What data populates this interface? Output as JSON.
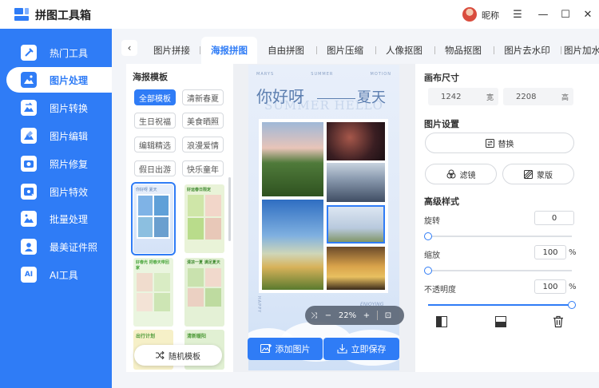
{
  "app": {
    "title": "拼图工具箱",
    "nickname": "昵称"
  },
  "window": {
    "menu_icon": "☰",
    "minimize_icon": "—",
    "maximize_icon": "☐",
    "close_icon": "✕"
  },
  "sidebar": {
    "items": [
      {
        "label": "热门工具",
        "icon": "tools-icon",
        "active": false
      },
      {
        "label": "图片处理",
        "icon": "image-process-icon",
        "active": true
      },
      {
        "label": "图片转换",
        "icon": "image-convert-icon",
        "active": false
      },
      {
        "label": "图片编辑",
        "icon": "image-edit-icon",
        "active": false
      },
      {
        "label": "照片修复",
        "icon": "photo-repair-icon",
        "active": false
      },
      {
        "label": "图片特效",
        "icon": "image-effect-icon",
        "active": false
      },
      {
        "label": "批量处理",
        "icon": "batch-icon",
        "active": false
      },
      {
        "label": "最美证件照",
        "icon": "id-photo-icon",
        "active": false
      },
      {
        "label": "AI工具",
        "icon": "ai-icon",
        "active": false
      }
    ]
  },
  "tabs": {
    "back_icon": "‹",
    "items": [
      {
        "label": "图片拼接",
        "active": false
      },
      {
        "label": "海报拼图",
        "active": true
      },
      {
        "label": "自由拼图",
        "active": false
      },
      {
        "label": "图片压缩",
        "active": false
      },
      {
        "label": "人像抠图",
        "active": false
      },
      {
        "label": "物品抠图",
        "active": false
      },
      {
        "label": "图片去水印",
        "active": false
      },
      {
        "label": "图片加水",
        "active": false
      }
    ]
  },
  "templates": {
    "title": "海报模板",
    "categories": [
      {
        "label": "全部模板",
        "active": true
      },
      {
        "label": "清新春夏",
        "active": false
      },
      {
        "label": "生日祝福",
        "active": false
      },
      {
        "label": "美食晒照",
        "active": false
      },
      {
        "label": "编辑精选",
        "active": false
      },
      {
        "label": "浪漫爱情",
        "active": false
      },
      {
        "label": "假日出游",
        "active": false
      },
      {
        "label": "快乐童年",
        "active": false
      }
    ],
    "thumbs": [
      {
        "caption": "你好呀 夏天",
        "selected": true
      },
      {
        "caption": "好运春日限定",
        "selected": false
      },
      {
        "caption": "好春光 把春天带回家",
        "selected": false
      },
      {
        "caption": "清凉一夏 满足夏天",
        "selected": false
      },
      {
        "caption": "出行计划",
        "selected": false
      },
      {
        "caption": "清新暖阳",
        "selected": false
      }
    ],
    "random_label": "随机模板"
  },
  "poster": {
    "top_left": "MARYS",
    "top_mid": "SUMMER",
    "top_right": "MOTION",
    "heading_left": "你好呀",
    "heading_right": "夏天",
    "bg_text": "SUMMER HELLO",
    "bottom_left": "HAPPY",
    "bottom_right": "ENJOYING"
  },
  "zoom": {
    "shuffle_icon": "⤨",
    "minus": "−",
    "value": "22%",
    "plus": "+",
    "fit_icon": "⊡"
  },
  "actions": {
    "add_image": "添加图片",
    "save_now": "立即保存"
  },
  "settings": {
    "canvas_size_title": "画布尺寸",
    "width": "1242",
    "width_unit": "宽",
    "height": "2208",
    "height_unit": "高",
    "image_settings_title": "图片设置",
    "replace_label": "替换",
    "filter_label": "滤镜",
    "mask_label": "蒙版",
    "advanced_title": "高级样式",
    "rotate_label": "旋转",
    "rotate_value": "0",
    "rotate_level": 0,
    "scale_label": "缩放",
    "scale_value": "100",
    "scale_unit": "%",
    "scale_level": 0,
    "opacity_label": "不透明度",
    "opacity_value": "100",
    "opacity_unit": "%",
    "opacity_level": 1.0
  }
}
